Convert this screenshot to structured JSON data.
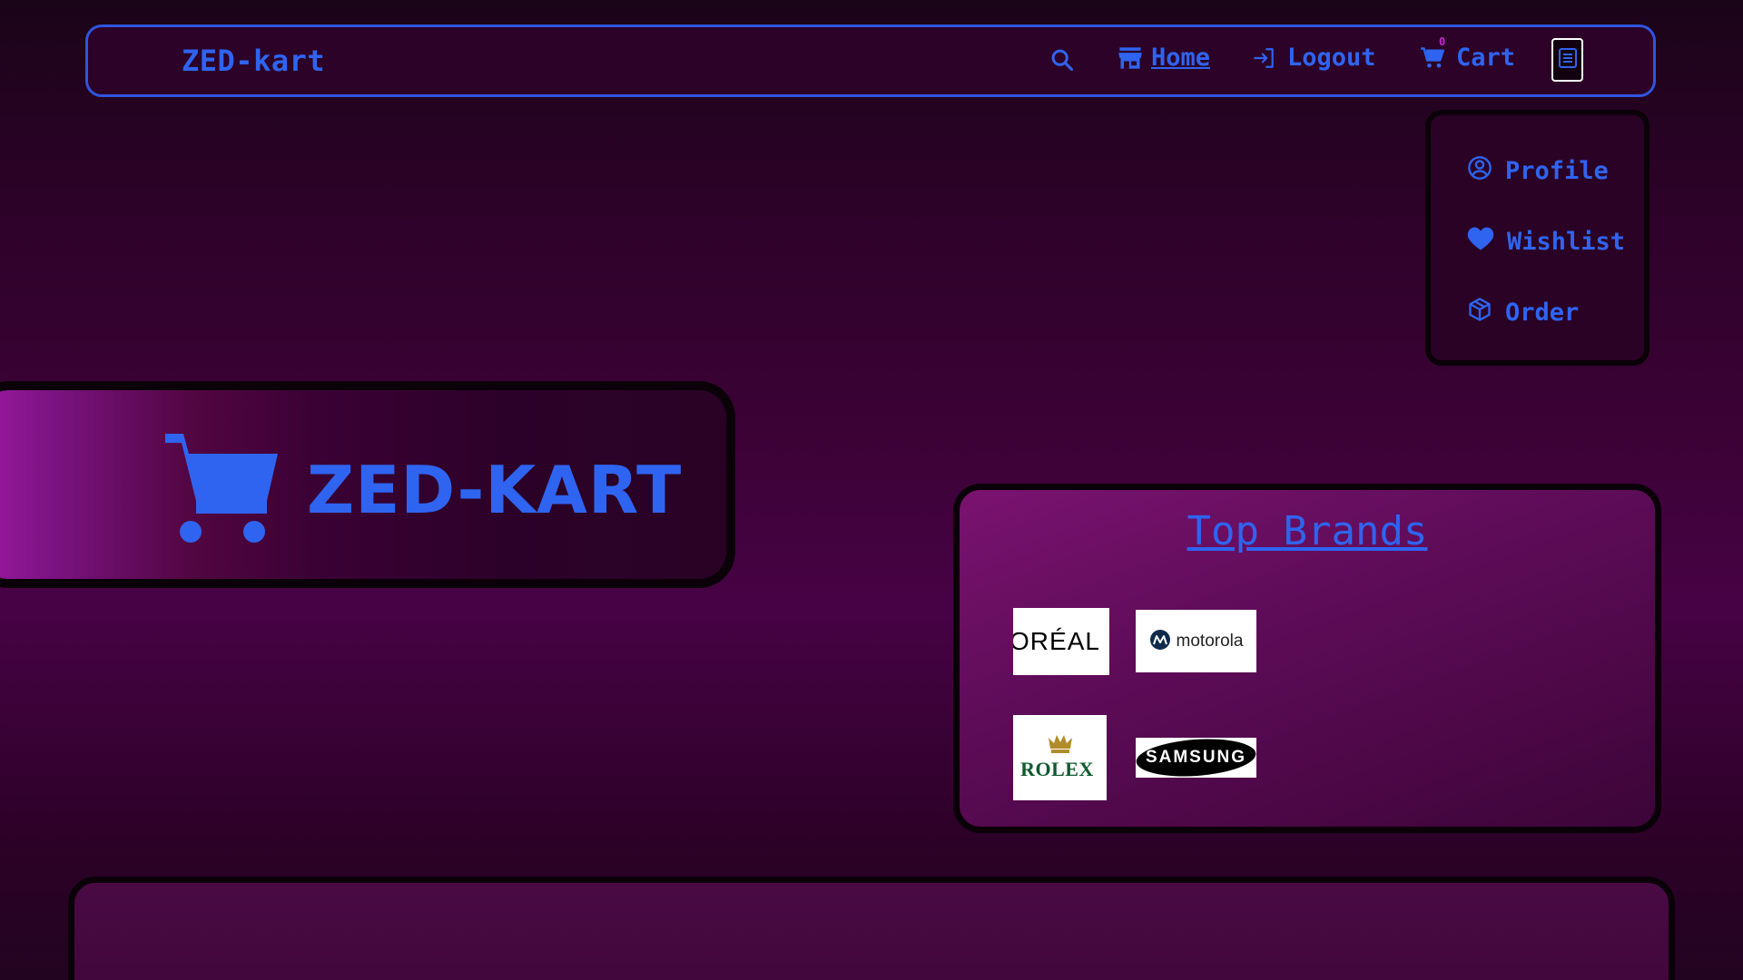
{
  "navbar": {
    "brand": "ZED-kart",
    "search_icon": "search-icon",
    "home": {
      "icon": "store-icon",
      "label": "Home"
    },
    "logout": {
      "icon": "login-arrow-icon",
      "label": "Logout"
    },
    "cart": {
      "icon": "cart-icon",
      "label": "Cart",
      "count": "0"
    },
    "menu_icon": "document-list-icon"
  },
  "dropdown": {
    "items": [
      {
        "icon": "user-circle-icon",
        "label": "Profile"
      },
      {
        "icon": "heart-icon",
        "label": "Wishlist"
      },
      {
        "icon": "box-icon",
        "label": "Order"
      }
    ]
  },
  "hero": {
    "icon": "shopping-cart-icon",
    "title": "ZED-KART"
  },
  "brands": {
    "title": "Top Brands",
    "logos": [
      {
        "name": "loreal",
        "text": "ORÉAL"
      },
      {
        "name": "motorola",
        "text": "motorola"
      },
      {
        "name": "rolex",
        "text": "ROLEX"
      },
      {
        "name": "samsung",
        "text": "SAMSUNG"
      }
    ]
  },
  "colors": {
    "accent": "#2f64f0",
    "border_dark": "#0b0109",
    "cart_count": "#c22ad0"
  }
}
